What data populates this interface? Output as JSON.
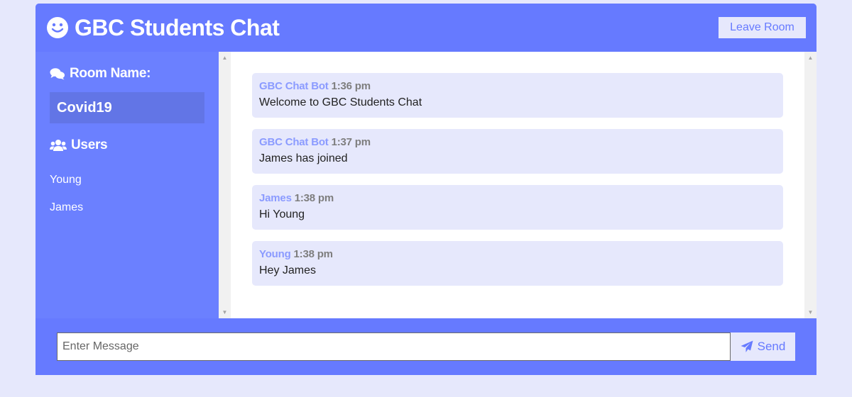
{
  "header": {
    "title": "GBC Students Chat",
    "leave_label": "Leave Room"
  },
  "sidebar": {
    "room_heading": "Room Name:",
    "room_name": "Covid19",
    "users_heading": "Users",
    "users": [
      "Young",
      "James"
    ]
  },
  "messages": [
    {
      "author": "GBC Chat Bot",
      "time": "1:36 pm",
      "text": "Welcome to GBC Students Chat"
    },
    {
      "author": "GBC Chat Bot",
      "time": "1:37 pm",
      "text": "James has joined"
    },
    {
      "author": "James",
      "time": "1:38 pm",
      "text": "Hi Young"
    },
    {
      "author": "Young",
      "time": "1:38 pm",
      "text": "Hey James"
    }
  ],
  "form": {
    "placeholder": "Enter Message",
    "value": "",
    "send_label": "Send"
  },
  "icons": {
    "title": "smile-icon",
    "room": "comments-icon",
    "users": "users-icon",
    "send": "paper-plane-icon"
  },
  "colors": {
    "primary": "#667aff",
    "light": "#e6e8fc",
    "room_highlight": "#6275e6"
  }
}
